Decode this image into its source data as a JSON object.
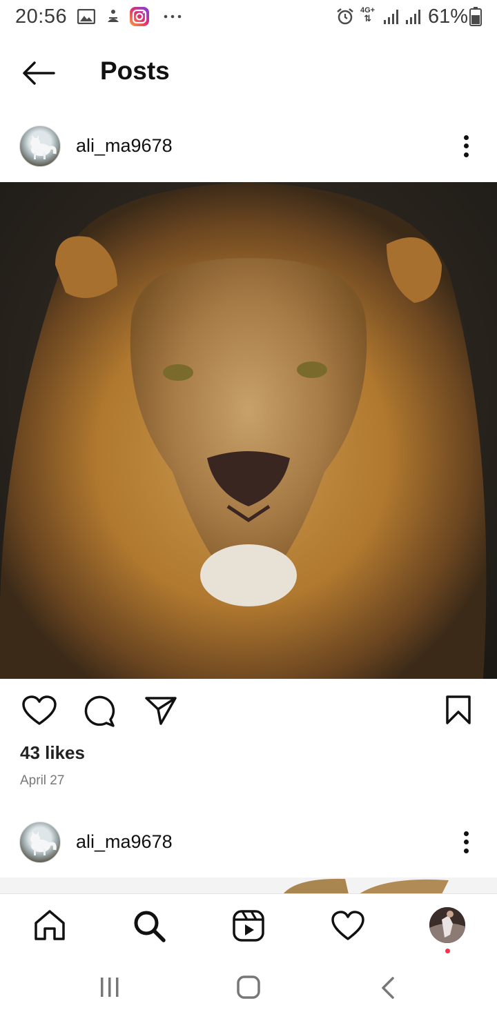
{
  "status_bar": {
    "time": "20:56",
    "network_label": "4G+",
    "battery_percent": "61%"
  },
  "header": {
    "back_icon": "arrow-left-icon",
    "title": "Posts"
  },
  "posts": [
    {
      "username": "ali_ma9678",
      "likes": "43 likes",
      "date": "April 27"
    },
    {
      "username": "ali_ma9678"
    }
  ],
  "bottom_nav": {
    "items": [
      "home-icon",
      "search-icon",
      "reels-icon",
      "activity-heart-icon",
      "profile-avatar"
    ]
  },
  "colors": {
    "notification_dot": "#ff2d4b"
  }
}
